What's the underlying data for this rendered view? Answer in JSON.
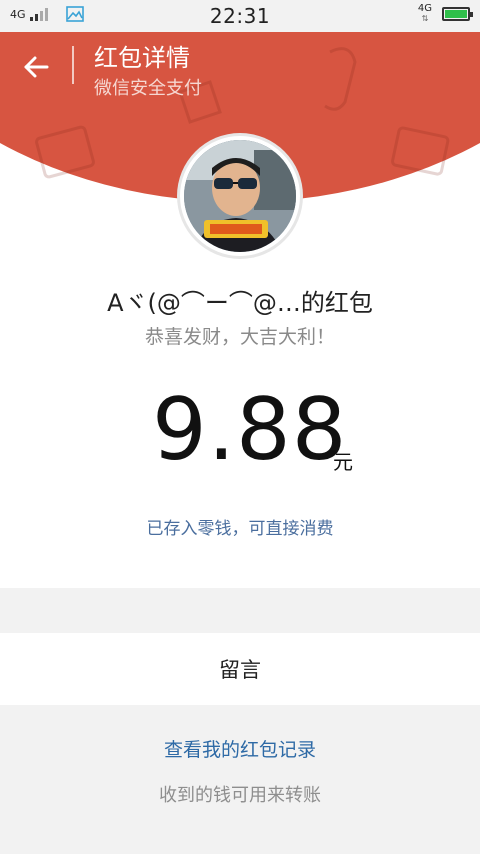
{
  "status_bar": {
    "network_left": "4G",
    "time": "22:31",
    "network_right": "4G",
    "network_right_arrows": "⇅"
  },
  "header": {
    "title": "红包详情",
    "subtitle": "微信安全支付",
    "background_color": "#d75541"
  },
  "packet": {
    "sender": "Aヾ(@⌒ー⌒@…的红包",
    "greeting": "恭喜发财，大吉大利！",
    "amount": "9.88",
    "unit": "元",
    "deposit_notice": "已存入零钱，可直接消费"
  },
  "actions": {
    "message_label": "留言",
    "records_link": "查看我的红包记录",
    "transfer_note": "收到的钱可用来转账"
  },
  "icons": {
    "back": "back-arrow-icon",
    "gallery": "image-icon",
    "battery": "battery-icon",
    "signal": "signal-icon"
  }
}
